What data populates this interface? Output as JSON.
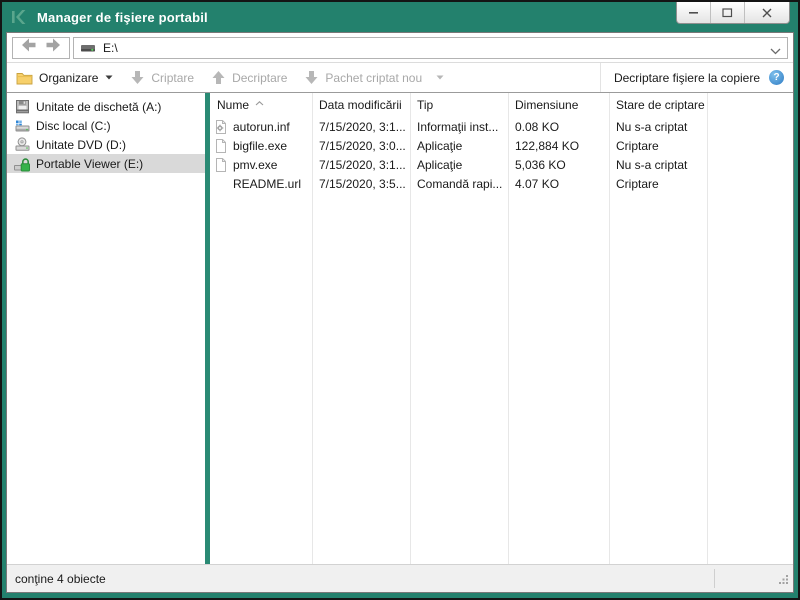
{
  "window": {
    "title": "Manager de fişiere portabil",
    "logo_icon": "kaspersky-logo-icon",
    "controls": [
      "minimize",
      "maximize",
      "close"
    ]
  },
  "navbar": {
    "back_icon": "back-arrow-icon",
    "forward_icon": "forward-arrow-icon",
    "drive_icon": "drive-icon",
    "address": "E:\\"
  },
  "toolbar": {
    "organize_label": "Organizare",
    "organize_icon": "folder-icon",
    "encrypt_label": "Criptare",
    "encrypt_icon": "arrow-down-icon",
    "decrypt_label": "Decriptare",
    "decrypt_icon": "arrow-up-icon",
    "new_package_label": "Pachet criptat nou",
    "new_package_icon": "arrow-down-icon",
    "decrypt_on_copy_label": "Decriptare fişiere la copiere",
    "help_icon": "help-icon",
    "help_glyph": "?"
  },
  "sidebar": {
    "items": [
      {
        "label": "Unitate de dischetă (A:)",
        "icon": "floppy-drive-icon",
        "selected": false
      },
      {
        "label": "Disc local (C:)",
        "icon": "local-disk-icon",
        "selected": false
      },
      {
        "label": "Unitate DVD (D:)",
        "icon": "dvd-drive-icon",
        "selected": false
      },
      {
        "label": "Portable Viewer (E:)",
        "icon": "encrypted-drive-icon",
        "selected": true
      }
    ]
  },
  "file_list": {
    "columns": [
      "Nume",
      "Data modificării",
      "Tip",
      "Dimensiune",
      "Stare de criptare"
    ],
    "sort": {
      "column": "Nume",
      "direction": "asc"
    },
    "rows": [
      {
        "icon": "config-file-icon",
        "name": "autorun.inf",
        "modified": "7/15/2020, 3:1...",
        "type": "Informaţii inst...",
        "size": "0.08 KO",
        "status": "Nu s-a criptat"
      },
      {
        "icon": "file-icon",
        "name": "bigfile.exe",
        "modified": "7/15/2020, 3:0...",
        "type": "Aplicaţie",
        "size": "122,884 KO",
        "status": "Criptare"
      },
      {
        "icon": "file-icon",
        "name": "pmv.exe",
        "modified": "7/15/2020, 3:1...",
        "type": "Aplicaţie",
        "size": "5,036 KO",
        "status": "Nu s-a criptat"
      },
      {
        "icon": "none",
        "name": "README.url",
        "modified": "7/15/2020, 3:5...",
        "type": "Comandă rapi...",
        "size": "4.07 KO",
        "status": "Criptare"
      }
    ]
  },
  "statusbar": {
    "text": "conţine 4 obiecte"
  },
  "colors": {
    "titlebar": "#23816d",
    "frame": "#23816d",
    "splitter": "#2a8a74",
    "selection": "#d9d9d9",
    "disabled_text": "#a8a8a8",
    "help_icon_blue": "#3d8fd6",
    "lock_green": "#35b24a",
    "folder_yellow": "#f7d06b"
  }
}
